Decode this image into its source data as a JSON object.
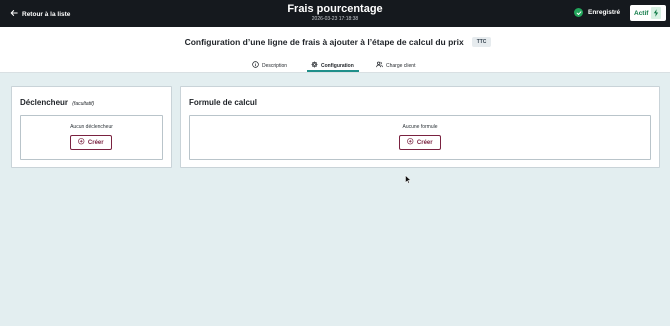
{
  "topbar": {
    "back_label": "Retour à la liste",
    "title": "Frais pourcentage",
    "timestamp": "2026-03-23 17:18:38",
    "saved_label": "Enregistré",
    "status_label": "Actif"
  },
  "subheader": {
    "title": "Configuration d’une ligne de frais à ajouter à l’étape de calcul du prix",
    "badge": "TTC"
  },
  "tabs": [
    {
      "label": "Description",
      "icon": "info-circle-icon",
      "active": false
    },
    {
      "label": "Configuration",
      "icon": "gear-icon",
      "active": true
    },
    {
      "label": "Charge client",
      "icon": "users-icon",
      "active": false
    }
  ],
  "cards": {
    "trigger": {
      "title": "Déclencheur",
      "optional": "(facultatif)",
      "empty_text": "Aucun déclencheur",
      "create_label": "Créer"
    },
    "formula": {
      "title": "Formule de calcul",
      "empty_text": "Aucune formule",
      "create_label": "Créer"
    }
  },
  "colors": {
    "topbar": "#15191e",
    "page_background": "#e3eef0",
    "accent_green": "#22a55b",
    "tab_underline": "#1f8f8a",
    "create_button": "#7a2240"
  }
}
